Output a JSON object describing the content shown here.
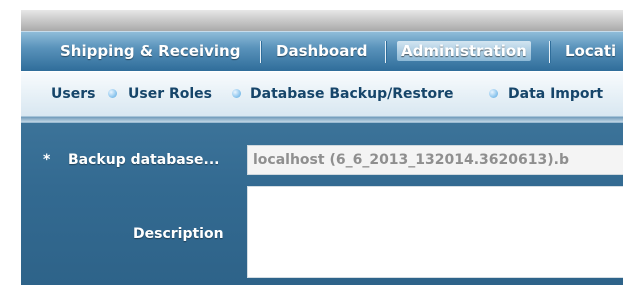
{
  "topnav": {
    "items": [
      {
        "label": "Shipping & Receiving"
      },
      {
        "label": "Dashboard"
      },
      {
        "label": "Administration",
        "active": true
      },
      {
        "label": "Locati"
      }
    ]
  },
  "subnav": {
    "items": [
      {
        "label": "Users"
      },
      {
        "label": "User Roles"
      },
      {
        "label": "Database Backup/Restore"
      },
      {
        "label": "Data Import"
      }
    ]
  },
  "form": {
    "required_marker": "*",
    "backup_label": "Backup database...",
    "backup_value": "localhost (6_6_2013_132014.3620613).b",
    "description_label": "Description",
    "description_value": ""
  }
}
